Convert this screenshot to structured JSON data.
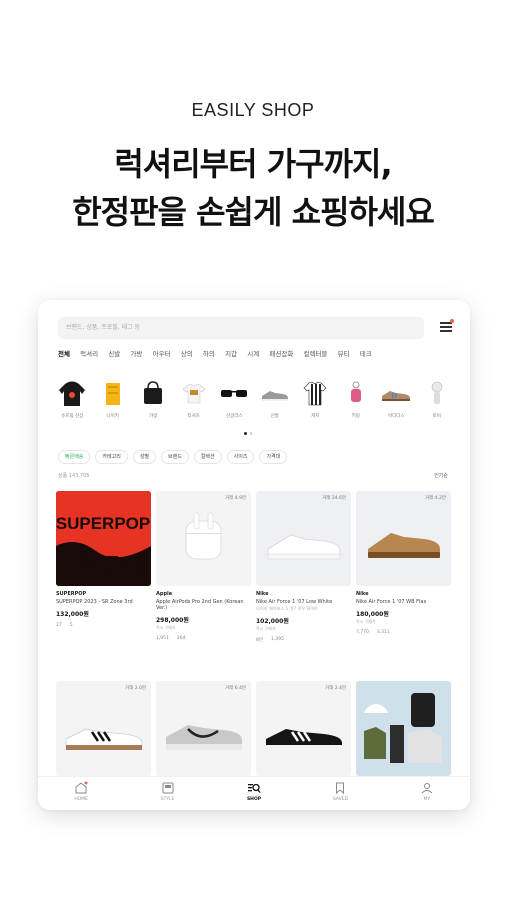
{
  "header": {
    "eyebrow": "EASILY SHOP",
    "line1": "럭셔리부터 가구까지,",
    "line2": "한정판을 손쉽게 쇼핑하세요"
  },
  "search": {
    "placeholder": "브랜드, 상품, 프로필, 태그 등"
  },
  "categories": [
    "전체",
    "럭셔리",
    "신발",
    "가방",
    "아우터",
    "상의",
    "하의",
    "지갑",
    "시계",
    "패션잡화",
    "컬렉터블",
    "뷰티",
    "테크"
  ],
  "icon_row": [
    {
      "label": "슈프림 신상",
      "icon": "hoodie-icon"
    },
    {
      "label": "나이키",
      "icon": "yellow-box-icon"
    },
    {
      "label": "가방",
      "icon": "black-bag-icon"
    },
    {
      "label": "티셔츠",
      "icon": "tshirt-icon"
    },
    {
      "label": "선글라스",
      "icon": "sunglasses-icon"
    },
    {
      "label": "신발",
      "icon": "sneaker-icon"
    },
    {
      "label": "저지",
      "icon": "jersey-icon"
    },
    {
      "label": "키링",
      "icon": "keyring-icon"
    },
    {
      "label": "아디다스",
      "icon": "sneaker-brown-icon"
    },
    {
      "label": "토이",
      "icon": "figure-icon"
    }
  ],
  "filters": [
    "빠른배송",
    "카테고리",
    "성별",
    "브랜드",
    "컬렉션",
    "사이즈",
    "가격대"
  ],
  "product_count": "상품 143,705",
  "sort_label": "인기순",
  "products": [
    {
      "brand": "SUPERPOP",
      "name": "SUPERPOP 2023 - SR Zone 3rd",
      "sub": "",
      "price": "132,000원",
      "price_sub": "",
      "trade_count": "",
      "meta1": "27",
      "meta2": "5"
    },
    {
      "brand": "Apple",
      "name": "Apple AirPods Pro 2nd Gen (Korean Ver.)",
      "sub": "",
      "price": "298,000원",
      "price_sub": "즉시 구매가",
      "trade_count": "거래 4.9만",
      "meta1": "1,951",
      "meta2": "264"
    },
    {
      "brand": "Nike",
      "name": "Nike Air Force 1 '07 Low White",
      "sub": "나이키 에어포스 1 '07 로우 화이트",
      "price": "102,000원",
      "price_sub": "즉시 구매가",
      "trade_count": "거래 24.6만",
      "meta1": "8만",
      "meta2": "1,395"
    },
    {
      "brand": "Nike",
      "name": "Nike Air Force 1 '07 WB Flax",
      "sub": "",
      "price": "180,000원",
      "price_sub": "즉시 구매가",
      "trade_count": "거래 4.2만",
      "meta1": "7,770",
      "meta2": "3,311"
    },
    {
      "brand": "",
      "name": "",
      "sub": "",
      "price": "",
      "price_sub": "",
      "trade_count": "거래 2.0만",
      "meta1": "",
      "meta2": ""
    },
    {
      "brand": "",
      "name": "",
      "sub": "",
      "price": "",
      "price_sub": "",
      "trade_count": "거래 6.4만",
      "meta1": "",
      "meta2": ""
    },
    {
      "brand": "",
      "name": "",
      "sub": "",
      "price": "",
      "price_sub": "",
      "trade_count": "거래 2.4만",
      "meta1": "",
      "meta2": ""
    },
    {
      "brand": "",
      "name": "",
      "sub": "",
      "price": "",
      "price_sub": "",
      "trade_count": "",
      "meta1": "",
      "meta2": ""
    }
  ],
  "tabs": [
    "HOME",
    "STYLE",
    "SHOP",
    "SAVED",
    "MY"
  ],
  "colors": {
    "accent_red": "#ef6253",
    "green": "#31b46e",
    "superpop_red": "#e63323"
  }
}
